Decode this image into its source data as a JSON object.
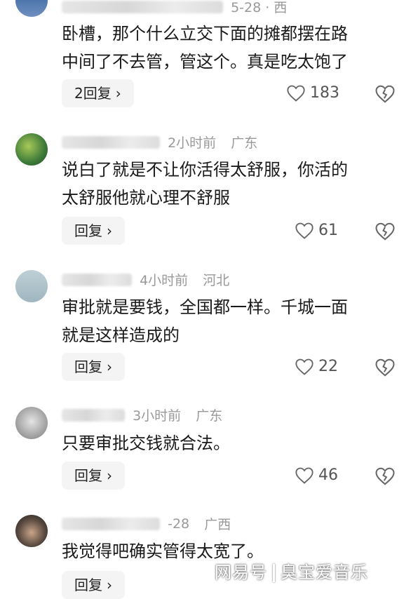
{
  "comments": [
    {
      "date": "5-28 · 西",
      "text_lines": [
        "卧槽，那个什么立交下面的摊都摆在路",
        "中间了不去管，管这个。真是吃太饱了"
      ],
      "reply_label": "2回复",
      "likes": "183"
    },
    {
      "time": "2小时前",
      "location": "广东",
      "text_lines": [
        "说白了就是不让你活得太舒服，你活的",
        "太舒服他就心理不舒服"
      ],
      "reply_label": "回复",
      "likes": "61"
    },
    {
      "time": "4小时前",
      "location": "河北",
      "text_lines": [
        "审批就是要钱，全国都一样。千城一面",
        "就是这样造成的"
      ],
      "reply_label": "回复",
      "likes": "22"
    },
    {
      "time": "3小时前",
      "location": "广东",
      "text_lines": [
        "只要审批交钱就合法。"
      ],
      "reply_label": "回复",
      "likes": "46"
    },
    {
      "time": "-28",
      "location": "广西",
      "text_lines": [
        "我觉得吧确实管得太宽了。"
      ],
      "reply_label": "回复"
    }
  ],
  "watermark": {
    "left": "网易号",
    "right": "臭宝爱音乐"
  },
  "icons": {
    "reply_chevron": "chevron-right-icon",
    "like": "heart-icon",
    "dislike": "broken-heart-icon"
  }
}
